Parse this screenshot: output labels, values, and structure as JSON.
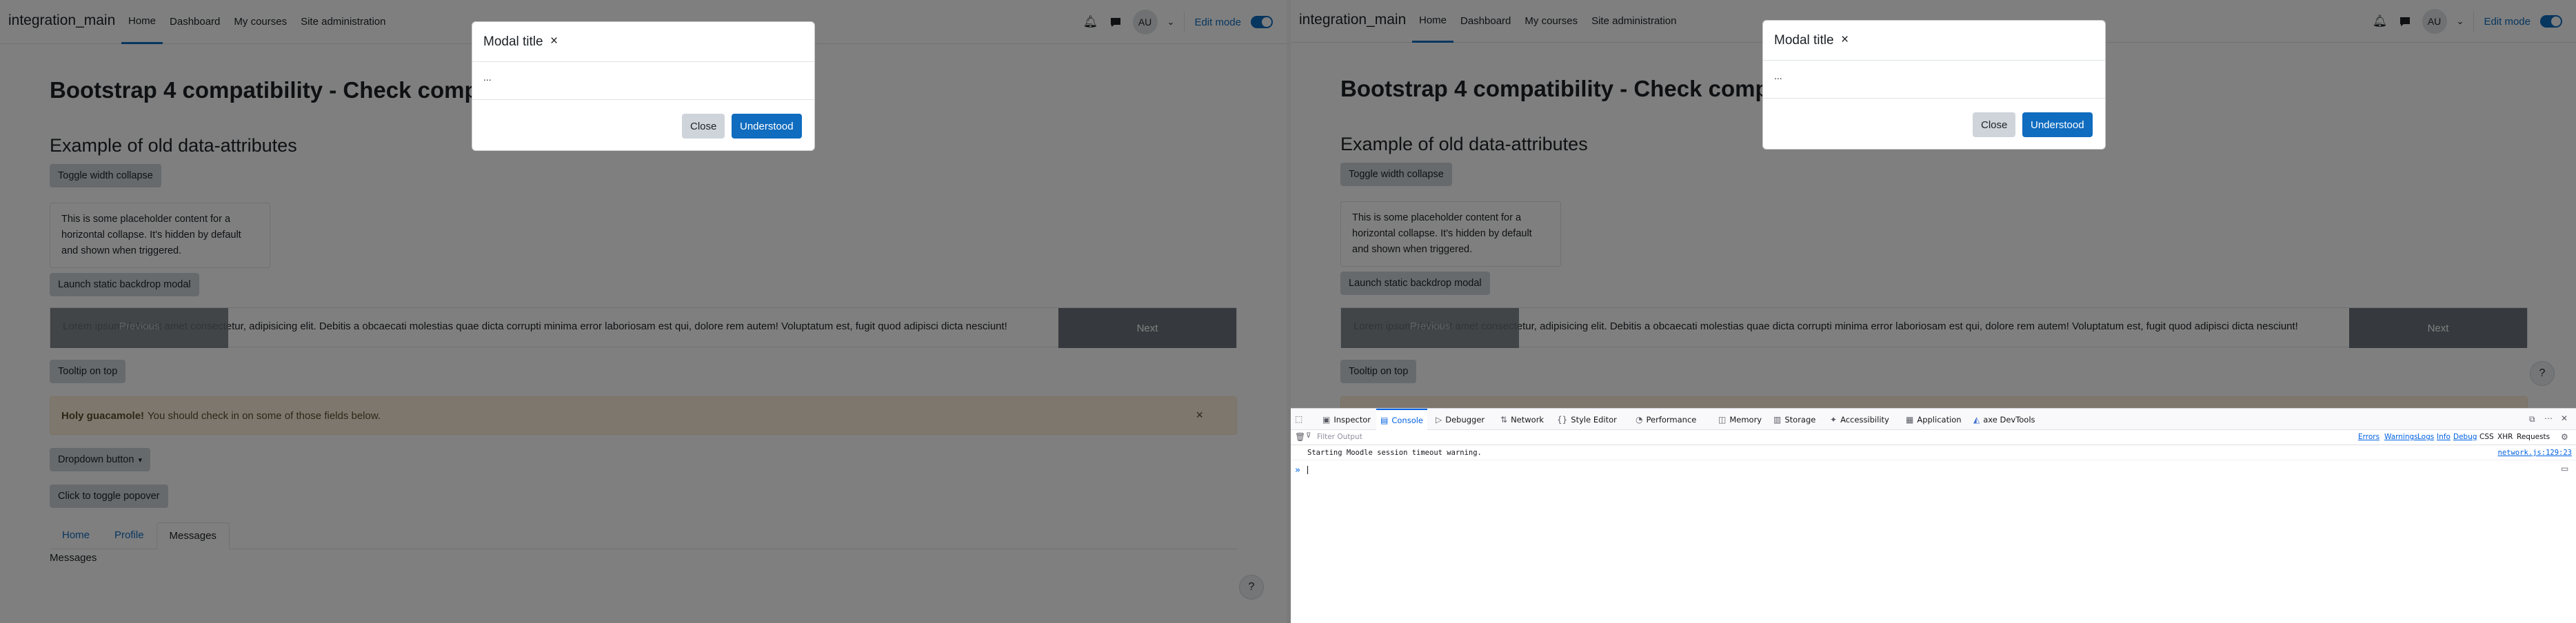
{
  "navbar": {
    "brand": "integration_main",
    "links": [
      "Home",
      "Dashboard",
      "My courses",
      "Site administration"
    ],
    "avatar_initials": "AU",
    "edit_mode_label": "Edit mode",
    "icons": [
      "bell-icon",
      "chat-icon",
      "chevron-down-icon"
    ]
  },
  "page": {
    "title": "Bootstrap 4 compatibility - Check compatibility",
    "subtitle": "Example of old data-attributes",
    "btn_toggle_width": "Toggle width collapse",
    "collapse_text": "This is some placeholder content for a horizontal collapse. It's hidden by default and shown when triggered.",
    "btn_static_modal": "Launch static backdrop modal",
    "carousel_text": "Lorem ipsum dolor sit amet consectetur, adipisicing elit. Debitis a obcaecati molestias quae dicta corrupti minima error laboriosam est qui, dolore rem autem! Voluptatum est, fugit quod adipisci dicta nesciunt!",
    "carousel_prev": "Previous",
    "carousel_next": "Next",
    "btn_tooltip": "Tooltip on top",
    "alert_strong": "Holy guacamole!",
    "alert_text": "You should check in on some of those fields below.",
    "alert_close": "×",
    "btn_dropdown": "Dropdown button",
    "btn_popover": "Click to toggle popover",
    "tabs": [
      "Home",
      "Profile",
      "Messages"
    ],
    "active_tab_content": "Messages",
    "help_icon": "?"
  },
  "modal": {
    "title": "Modal title",
    "close_x": "×",
    "body": "...",
    "close_label": "Close",
    "understood_label": "Understood"
  },
  "devtools": {
    "tabs": [
      "Inspector",
      "Console",
      "Debugger",
      "Network",
      "Style Editor",
      "Performance",
      "Memory",
      "Storage",
      "Accessibility",
      "Application",
      "axe DevTools"
    ],
    "active_tab": "Console",
    "filter_placeholder": "Filter Output",
    "levels": [
      "Errors",
      "Warnings",
      "Logs",
      "Info",
      "Debug"
    ],
    "requests": [
      "CSS",
      "XHR",
      "Requests"
    ],
    "message": "Starting Moodle session timeout warning.",
    "message_source": "network.js:129:23",
    "prompt": "»"
  },
  "colors": {
    "accent": "#0f6cbf",
    "backdrop": "rgba(0,0,0,0.5)",
    "devtools_accent": "#0061e0"
  }
}
